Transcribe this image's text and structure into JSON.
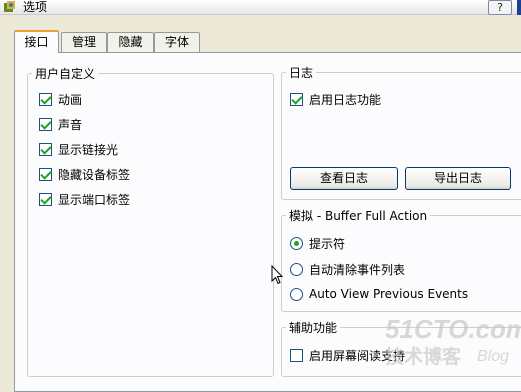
{
  "window": {
    "title": "选项",
    "help_label": "?"
  },
  "tabs": [
    {
      "label": "接口",
      "active": true
    },
    {
      "label": "管理",
      "active": false
    },
    {
      "label": "隐藏",
      "active": false
    },
    {
      "label": "字体",
      "active": false
    }
  ],
  "custom": {
    "title": "用户自定义",
    "options": [
      {
        "label": "动画",
        "checked": true
      },
      {
        "label": "声音",
        "checked": true
      },
      {
        "label": "显示链接光",
        "checked": true
      },
      {
        "label": "隐藏设备标签",
        "checked": true
      },
      {
        "label": "显示端口标签",
        "checked": true
      }
    ]
  },
  "log": {
    "title": "日志",
    "enable_label": "启用日志功能",
    "enable_checked": true,
    "view_button": "查看日志",
    "export_button": "导出日志"
  },
  "simulation": {
    "title": "模拟 - Buffer Full Action",
    "options": [
      {
        "label": "提示符",
        "selected": true
      },
      {
        "label": "自动清除事件列表",
        "selected": false
      },
      {
        "label": "Auto View Previous Events",
        "selected": false
      }
    ]
  },
  "accessibility": {
    "title": "辅助功能",
    "screen_reader_label": "启用屏幕阅读支持",
    "screen_reader_checked": false
  },
  "watermark": {
    "brand": "51CTO.com",
    "subtitle": "技术博客",
    "blog": "Blog"
  },
  "colors": {
    "accent_tab": "#f0a030",
    "check": "#21a121",
    "title_bar_edge": "#1b3f9b"
  }
}
